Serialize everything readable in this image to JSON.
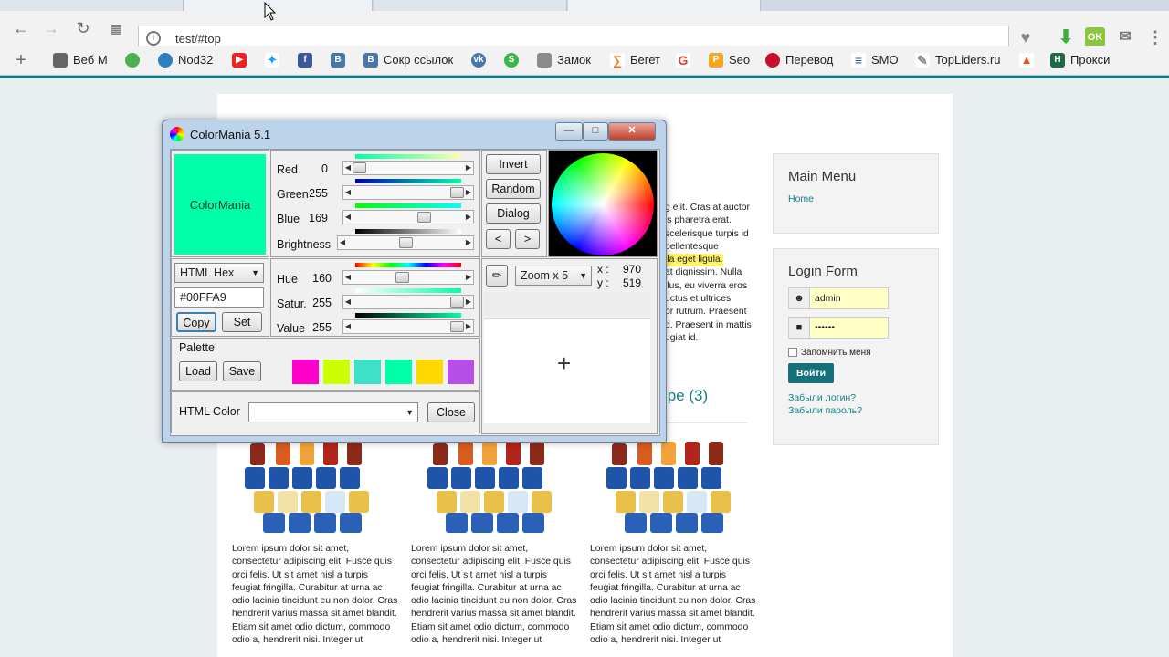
{
  "browser": {
    "url": "test/#top",
    "bookmarks": [
      "Веб М",
      "",
      "Nod32",
      "",
      "",
      "",
      "",
      "Сокр ссылок",
      "",
      "",
      "Замок",
      "Бегет",
      "",
      "Seo",
      "Перевод",
      "SMO",
      "TopLiders.ru",
      "",
      "Прокси"
    ],
    "bookmark_icons": [
      "folder-icon",
      "whatsapp-icon",
      "nod32-icon",
      "youtube-icon",
      "twitter-icon",
      "facebook-icon",
      "vkontakte-icon",
      "vkontakte-icon",
      "vk-icon",
      "skype-icon",
      "castle-icon",
      "beget-icon",
      "google-icon",
      "seo-icon",
      "translate-icon",
      "smo-icon",
      "topliders-icon",
      "flame-icon",
      "proxy-icon"
    ]
  },
  "page": {
    "lorem_right": [
      "g elit. Cras at auctor",
      "is pharetra erat.",
      "scelerisque turpis id",
      "pellentesque",
      "lla eget ligula.",
      "at dignissim. Nulla",
      "llus, eu viverra eros",
      "uctus et ultrices",
      "or rutrum. Praesent",
      "d. Praesent in mattis",
      "ugiat id."
    ],
    "section_heading": "юре (3)",
    "lorem_cols": [
      "Lorem ipsum dolor sit amet, consectetur adipiscing elit. Fusce quis orci felis. Ut sit amet nisl a turpis feugiat fringilla. Curabitur at urna ac odio lacinia tincidunt eu non dolor. Cras hendrerit varius massa sit amet blandit. Etiam sit amet odio dictum, commodo odio a, hendrerit nisi. Integer ut",
      "Lorem ipsum dolor sit amet, consectetur adipiscing elit. Fusce quis orci felis. Ut sit amet nisl a turpis feugiat fringilla. Curabitur at urna ac odio lacinia tincidunt eu non dolor. Cras hendrerit varius massa sit amet blandit. Etiam sit amet odio dictum, commodo odio a, hendrerit nisi. Integer ut",
      "Lorem ipsum dolor sit amet, consectetur adipiscing elit. Fusce quis orci felis. Ut sit amet nisl a turpis feugiat fringilla. Curabitur at urna ac odio lacinia tincidunt eu non dolor. Cras hendrerit varius massa sit amet blandit. Etiam sit amet odio dictum, commodo odio a, hendrerit nisi. Integer ut"
    ],
    "main_menu": {
      "title": "Main Menu",
      "home": "Home"
    },
    "login": {
      "title": "Login Form",
      "username": "admin",
      "password": "••••••",
      "remember": "Запомнить меня",
      "submit": "Войти",
      "forgot_login": "Забыли логин?",
      "forgot_password": "Забыли пароль?"
    }
  },
  "colormania": {
    "title": "ColorMania 5.1",
    "preview_label": "ColorMania",
    "preview_color": "#00FFA9",
    "red_label": "Red",
    "red": "0",
    "green_label": "Green",
    "green": "255",
    "blue_label": "Blue",
    "blue": "169",
    "brightness_label": "Brightness",
    "hue_label": "Hue",
    "hue": "160",
    "sat_label": "Satur.",
    "sat": "255",
    "value_label": "Value",
    "value": "255",
    "format": "HTML Hex",
    "hex": "#00FFA9",
    "copy": "Copy",
    "set": "Set",
    "invert": "Invert",
    "random": "Random",
    "dialog": "Dialog",
    "prev": "<",
    "next": ">",
    "zoom": "Zoom x 5",
    "x_label": "x :",
    "x": "970",
    "y_label": "y :",
    "y": "519",
    "palette_label": "Palette",
    "load": "Load",
    "save": "Save",
    "palette": [
      "#ff00cc",
      "#ccff00",
      "#3fe0c8",
      "#00ffa9",
      "#ffd800",
      "#b84ee8"
    ],
    "html_color_label": "HTML Color",
    "close": "Close",
    "levels": {
      "red": 0.0,
      "green": 1.0,
      "blue": 0.66,
      "brightness": 0.5,
      "hue": 0.44,
      "sat": 1.0,
      "value": 1.0
    }
  }
}
